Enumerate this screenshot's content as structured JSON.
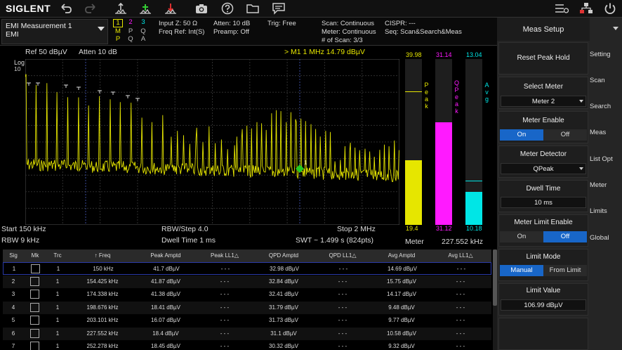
{
  "toolbar": {
    "brand": "SIGLENT"
  },
  "measurement": {
    "title": "EMI Measurement 1",
    "mode": "EMI"
  },
  "traces": {
    "numbers": [
      "1",
      "2",
      "3"
    ],
    "row2": [
      "M",
      "P",
      "Q"
    ],
    "row3": [
      "P",
      "Q",
      "A"
    ]
  },
  "info": {
    "input_z": "Input Z: 50 Ω",
    "freq_ref": "Freq Ref: Int(S)",
    "atten": "Atten: 10 dB",
    "preamp": "Preamp: Off",
    "trig": "Trig: Free",
    "scan": "Scan: Continuous",
    "meter": "Meter: Continuous",
    "num_scan": "# of Scan: 3/3",
    "cispr": "CISPR: ---",
    "seq": "Seq: Scan&Search&Meas"
  },
  "spectrum": {
    "ref": "Ref  50 dBµV",
    "atten": "Atten  10 dB",
    "marker": "> M1   1 MHz   14.79 dBµV",
    "scale_label": "Log",
    "y_ticks": [
      "10",
      "",
      "",
      "",
      "",
      "",
      "",
      "",
      "",
      "",
      "",
      "",
      "",
      ""
    ],
    "start": "Start  150 kHz",
    "rbw": "RBW  9 kHz",
    "rbw_step": "RBW/Step  4.0",
    "dwell": "Dwell Time  1 ms",
    "stop": "Stop  2 MHz",
    "swt": "SWT ~  1.499 s (824pts)",
    "marker_flag": "1"
  },
  "meter_bars": {
    "peak_top": "39.98",
    "qpeak_top": "31.14",
    "avg_top": "13.04",
    "peak_bottom": "19.4",
    "qpeak_bottom": "31.12",
    "avg_bottom": "10.18",
    "peak_label": "Peak",
    "qpeak_label": "QPeak",
    "avg_label": "Avg",
    "meter_label": "Meter",
    "meter_freq": "227.552 kHz",
    "peak_color": "#e6e600",
    "qpeak_color": "#ff1aff",
    "avg_color": "#00e6e6",
    "peak_level": 0.39,
    "qpeak_level": 0.62,
    "avg_level": 0.2
  },
  "table": {
    "headers": [
      "Sig",
      "Mk",
      "Trc",
      "↑  Freq",
      "Peak Amptd",
      "Peak LL1△",
      "QPD Amptd",
      "QPD LL1△",
      "Avg Amptd",
      "Avg LL1△"
    ],
    "rows": [
      {
        "sig": "1",
        "trc": "1",
        "freq": "150 kHz",
        "peak": "41.7 dBµV",
        "peak_ll": "- - -",
        "qpd": "32.98 dBµV",
        "qpd_ll": "- - -",
        "avg": "14.69 dBµV",
        "avg_ll": "- - -"
      },
      {
        "sig": "2",
        "trc": "1",
        "freq": "154.425 kHz",
        "peak": "41.87 dBµV",
        "peak_ll": "- - -",
        "qpd": "32.84 dBµV",
        "qpd_ll": "- - -",
        "avg": "15.75 dBµV",
        "avg_ll": "- - -"
      },
      {
        "sig": "3",
        "trc": "1",
        "freq": "174.338 kHz",
        "peak": "41.38 dBµV",
        "peak_ll": "- - -",
        "qpd": "32.41 dBµV",
        "qpd_ll": "- - -",
        "avg": "14.17 dBµV",
        "avg_ll": "- - -"
      },
      {
        "sig": "4",
        "trc": "1",
        "freq": "198.676 kHz",
        "peak": "18.41 dBµV",
        "peak_ll": "- - -",
        "qpd": "31.79 dBµV",
        "qpd_ll": "- - -",
        "avg": "9.48 dBµV",
        "avg_ll": "- - -"
      },
      {
        "sig": "5",
        "trc": "1",
        "freq": "203.101 kHz",
        "peak": "16.07 dBµV",
        "peak_ll": "- - -",
        "qpd": "31.73 dBµV",
        "qpd_ll": "- - -",
        "avg": "9.77 dBµV",
        "avg_ll": "- - -"
      },
      {
        "sig": "6",
        "trc": "1",
        "freq": "227.552 kHz",
        "peak": "18.4 dBµV",
        "peak_ll": "- - -",
        "qpd": "31.1 dBµV",
        "qpd_ll": "- - -",
        "avg": "10.58 dBµV",
        "avg_ll": "- - -"
      },
      {
        "sig": "7",
        "trc": "1",
        "freq": "252.278 kHz",
        "peak": "18.45 dBµV",
        "peak_ll": "- - -",
        "qpd": "30.32 dBµV",
        "qpd_ll": "- - -",
        "avg": "9.32 dBµV",
        "avg_ll": "- - -"
      }
    ]
  },
  "panel": {
    "title": "Meas Setup",
    "reset": "Reset Peak Hold",
    "select_meter_label": "Select Meter",
    "select_meter_value": "Meter 2",
    "meter_enable_label": "Meter Enable",
    "meter_enable_on": "On",
    "meter_enable_off": "Off",
    "detector_label": "Meter Detector",
    "detector_value": "QPeak",
    "dwell_label": "Dwell Time",
    "dwell_value": "10 ms",
    "limit_enable_label": "Meter Limit Enable",
    "limit_enable_on": "On",
    "limit_enable_off": "Off",
    "limit_mode_label": "Limit Mode",
    "limit_mode_manual": "Manual",
    "limit_mode_from": "From Limit",
    "limit_value_label": "Limit Value",
    "limit_value": "106.99 dBµV"
  },
  "tabs": [
    "Setting",
    "Scan",
    "Search",
    "Meas",
    "List Opt",
    "Meter",
    "Limits",
    "Global"
  ],
  "colors": {
    "trace": "#e6e600",
    "accent": "#1866c8",
    "trace2": "#ff1aff",
    "trace3": "#00e6e6"
  }
}
